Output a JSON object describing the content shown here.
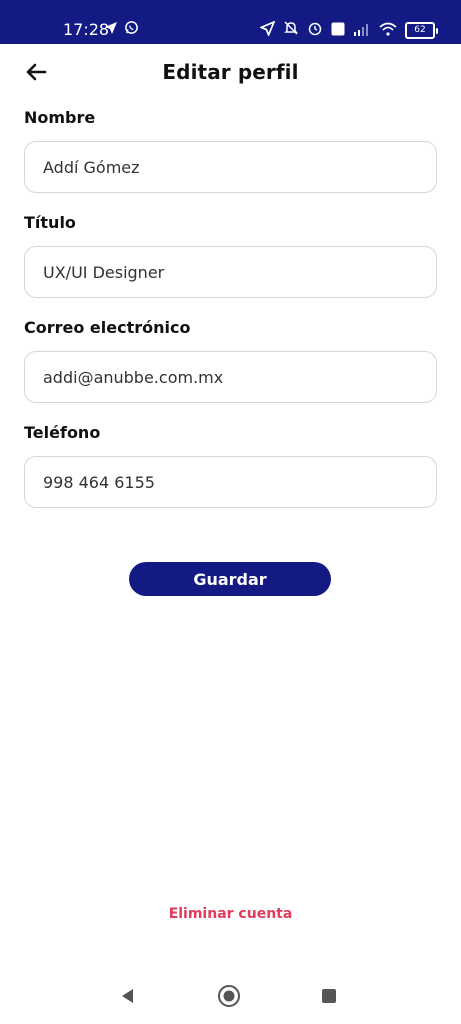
{
  "status_bar": {
    "time": "17:28",
    "battery": "62",
    "left_icons": [
      "location-arrow-icon",
      "whatsapp-icon"
    ],
    "right_icons": [
      "navigation-icon",
      "notifications-off-icon",
      "alarm-icon",
      "volte-icon",
      "signal-icon",
      "wifi-icon",
      "battery-icon"
    ]
  },
  "header": {
    "title": "Editar perfil",
    "back_icon": "arrow-left-icon"
  },
  "form": {
    "fields": [
      {
        "label": "Nombre",
        "value": "Addí Gómez"
      },
      {
        "label": "Título",
        "value": "UX/UI Designer"
      },
      {
        "label": "Correo electrónico",
        "value": "addi@anubbe.com.mx"
      },
      {
        "label": "Teléfono",
        "value": "998 464 6155"
      }
    ]
  },
  "actions": {
    "save_label": "Guardar",
    "delete_label": "Eliminar cuenta"
  },
  "colors": {
    "primary": "#131a84",
    "danger": "#e23b5b",
    "border": "#d7d7d7"
  }
}
